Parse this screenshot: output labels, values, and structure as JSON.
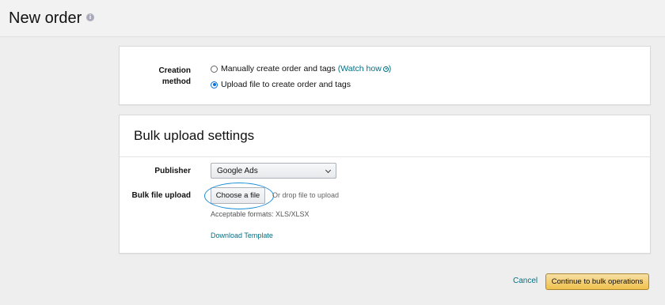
{
  "header": {
    "title": "New order",
    "info_icon": "info-icon"
  },
  "creation": {
    "label_line1": "Creation",
    "label_line2": "method",
    "options": [
      {
        "label": "Manually create order and tags",
        "checked": false
      },
      {
        "label": "Upload file to create order and tags",
        "checked": true
      }
    ],
    "watch_how_open": "(",
    "watch_how_label": "Watch how",
    "watch_how_close": ")"
  },
  "bulk": {
    "title": "Bulk upload settings",
    "publisher_label": "Publisher",
    "publisher_value": "Google Ads",
    "bulk_file_label": "Bulk file upload",
    "choose_file_label": "Choose a file",
    "drop_hint": "Or drop file to upload",
    "formats": "Acceptable formats: XLS/XLSX",
    "download_template": "Download Template"
  },
  "footer": {
    "cancel": "Cancel",
    "continue": "Continue to bulk operations"
  },
  "colors": {
    "link": "#007185",
    "primary_button": "#f0c14b",
    "highlight_ellipse": "#1e8fd8",
    "radio_selected": "#0a6fd8"
  }
}
